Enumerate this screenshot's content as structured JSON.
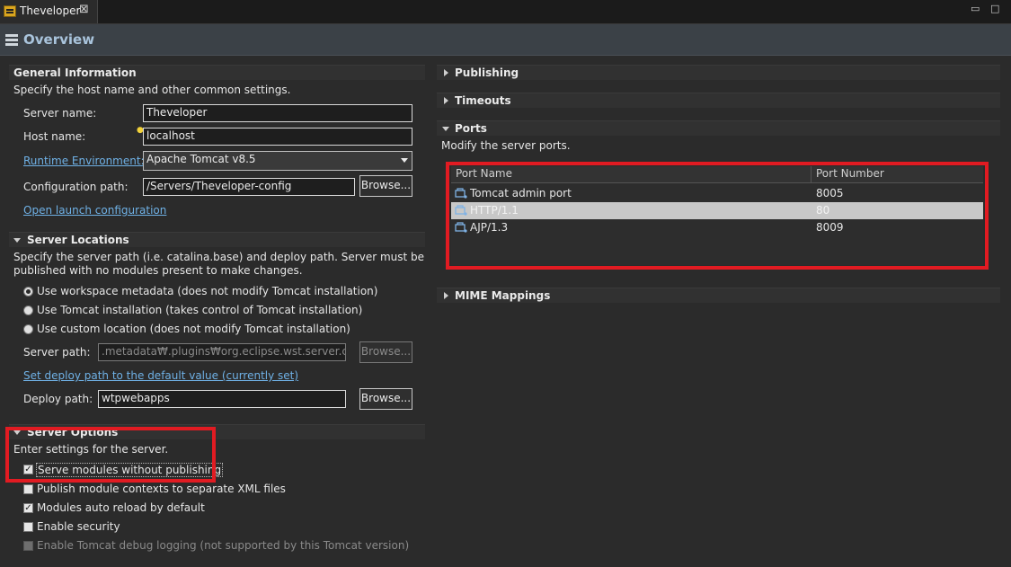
{
  "tab": {
    "title": "Theveloper",
    "close": "⊠"
  },
  "window_controls": {
    "minimize": "▭",
    "maximize": "□"
  },
  "header": {
    "title": "Overview"
  },
  "general": {
    "title": "General Information",
    "desc": "Specify the host name and other common settings.",
    "server_name_label": "Server name:",
    "server_name_value": "Theveloper",
    "host_name_label": "Host name:",
    "host_name_value": "localhost",
    "runtime_label": "Runtime Environment:",
    "runtime_value": "Apache Tomcat v8.5",
    "config_path_label": "Configuration path:",
    "config_path_value": "/Servers/Theveloper-config",
    "browse": "Browse...",
    "open_launch": "Open launch configuration"
  },
  "locations": {
    "title": "Server Locations",
    "desc1": "Specify the server path (i.e. catalina.base) and deploy path. Server must be",
    "desc2": "published with no modules present to make changes.",
    "opt1": "Use workspace metadata (does not modify Tomcat installation)",
    "opt2": "Use Tomcat installation (takes control of Tomcat installation)",
    "opt3": "Use custom location (does not modify Tomcat installation)",
    "server_path_label": "Server path:",
    "server_path_value": ".metadata₩.plugins₩org.eclipse.wst.server.core₩tr",
    "browse": "Browse...",
    "set_deploy_link": "Set deploy path to the default value (currently set)",
    "deploy_path_label": "Deploy path:",
    "deploy_path_value": "wtpwebapps"
  },
  "options": {
    "title": "Server Options",
    "desc": "Enter settings for the server.",
    "opt1": "Serve modules without publishing",
    "opt2": "Publish module contexts to separate XML files",
    "opt3": "Modules auto reload by default",
    "opt4": "Enable security",
    "opt5": "Enable Tomcat debug logging (not supported by this Tomcat version)"
  },
  "right": {
    "publishing": "Publishing",
    "timeouts": "Timeouts",
    "ports_title": "Ports",
    "ports_desc": "Modify the server ports.",
    "mime": "MIME Mappings"
  },
  "ports_table": {
    "col_name": "Port Name",
    "col_number": "Port Number",
    "rows": [
      {
        "name": "Tomcat admin port",
        "number": "8005"
      },
      {
        "name": "HTTP/1.1",
        "number": "80"
      },
      {
        "name": "AJP/1.3",
        "number": "8009"
      }
    ]
  },
  "colors": {
    "accent_link": "#6fb1e6",
    "highlight_red": "#e11b22",
    "header_title": "#a9c4dc"
  }
}
